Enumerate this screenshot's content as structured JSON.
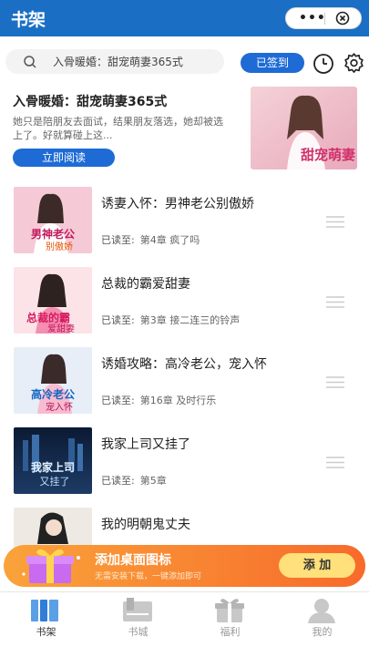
{
  "app": {
    "title": "书架",
    "capsule_dots": "•••"
  },
  "search": {
    "placeholder": "入骨暖婚：甜宠萌妻365式"
  },
  "toolbar": {
    "signin_label": "已签到"
  },
  "featured": {
    "title": "入骨暖婚：甜宠萌妻365式",
    "description": "她只是陪朋友去面试，结果朋友落选，她却被选上了。好就算碰上这...",
    "read_label": "立即阅读",
    "cover_text": "甜宠萌妻"
  },
  "books": [
    {
      "title": "诱妻入怀：男神老公别傲娇",
      "progress_label": "已读至:",
      "chapter": "第4章 疯了吗",
      "cover_text": "男神老公",
      "cover_sub": "别傲娇"
    },
    {
      "title": "总裁的霸爱甜妻",
      "progress_label": "已读至:",
      "chapter": "第3章 接二连三的铃声",
      "cover_text": "总裁的霸",
      "cover_sub": "爱甜妻"
    },
    {
      "title": "诱婚攻略：高冷老公，宠入怀",
      "progress_label": "已读至:",
      "chapter": "第16章 及时行乐",
      "cover_text": "高冷老公",
      "cover_sub": "宠入怀"
    },
    {
      "title": "我家上司又挂了",
      "progress_label": "已读至:",
      "chapter": "第5章",
      "cover_text": "我家上司",
      "cover_sub": "又挂了"
    },
    {
      "title": "我的明朝鬼丈夫",
      "progress_label": "",
      "chapter": "",
      "cover_text": "",
      "cover_sub": ""
    }
  ],
  "banner": {
    "title": "添加桌面图标",
    "subtitle": "无需安装下载，一键添加即可",
    "add_label": "添 加"
  },
  "tabs": [
    {
      "label": "书架",
      "icon": "bookshelf-icon",
      "active": true
    },
    {
      "label": "书城",
      "icon": "bookstore-icon",
      "active": false
    },
    {
      "label": "福利",
      "icon": "gift-icon",
      "active": false
    },
    {
      "label": "我的",
      "icon": "profile-icon",
      "active": false
    }
  ],
  "colors": {
    "primary": "#1a6fc4",
    "accent": "#1e6bd6",
    "banner_start": "#f9a33a",
    "banner_end": "#f86a2b"
  }
}
